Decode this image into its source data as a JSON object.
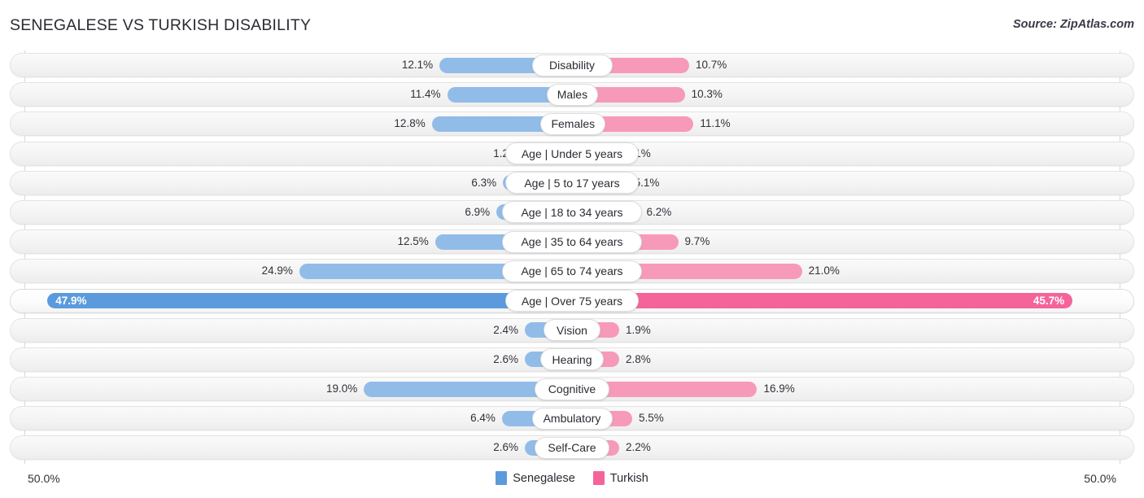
{
  "header": {
    "title": "SENEGALESE VS TURKISH DISABILITY",
    "source": "Source: ZipAtlas.com"
  },
  "axis": {
    "left_label": "50.0%",
    "right_label": "50.0%",
    "max": 50.0
  },
  "legend": {
    "items": [
      {
        "label": "Senegalese",
        "color": "#5b9bdd"
      },
      {
        "label": "Turkish",
        "color": "#f4649a"
      }
    ]
  },
  "colors": {
    "left_bar": "#92bce8",
    "right_bar": "#f79ab9",
    "left_bar_highlight": "#5b9bdd",
    "right_bar_highlight": "#f4649a",
    "track": "#f4f4f4",
    "gridline": "#d9d9de"
  },
  "chart_data": {
    "type": "bar",
    "title": "SENEGALESE VS TURKISH DISABILITY",
    "subtitle": "Source: ZipAtlas.com",
    "orientation": "horizontal-diverging",
    "xlabel": "",
    "ylabel": "",
    "xlim": [
      50.0,
      50.0
    ],
    "grid": false,
    "legend_position": "bottom-center",
    "categories": [
      "Disability",
      "Males",
      "Females",
      "Age | Under 5 years",
      "Age | 5 to 17 years",
      "Age | 18 to 34 years",
      "Age | 35 to 64 years",
      "Age | 65 to 74 years",
      "Age | Over 75 years",
      "Vision",
      "Hearing",
      "Cognitive",
      "Ambulatory",
      "Self-Care"
    ],
    "series": [
      {
        "name": "Senegalese",
        "color": "#92bce8",
        "values": [
          12.1,
          11.4,
          12.8,
          1.2,
          6.3,
          6.9,
          12.5,
          24.9,
          47.9,
          2.4,
          2.6,
          19.0,
          6.4,
          2.6
        ],
        "labels": [
          "12.1%",
          "11.4%",
          "12.8%",
          "1.2%",
          "6.3%",
          "6.9%",
          "12.5%",
          "24.9%",
          "47.9%",
          "2.4%",
          "2.6%",
          "19.0%",
          "6.4%",
          "2.6%"
        ]
      },
      {
        "name": "Turkish",
        "color": "#f79ab9",
        "values": [
          10.7,
          10.3,
          11.1,
          1.1,
          5.1,
          6.2,
          9.7,
          21.0,
          45.7,
          1.9,
          2.8,
          16.9,
          5.5,
          2.2
        ],
        "labels": [
          "10.7%",
          "10.3%",
          "11.1%",
          "1.1%",
          "5.1%",
          "6.2%",
          "9.7%",
          "21.0%",
          "45.7%",
          "1.9%",
          "2.8%",
          "16.9%",
          "5.5%",
          "2.2%"
        ]
      }
    ],
    "highlighted_row": "Age | Over 75 years"
  }
}
